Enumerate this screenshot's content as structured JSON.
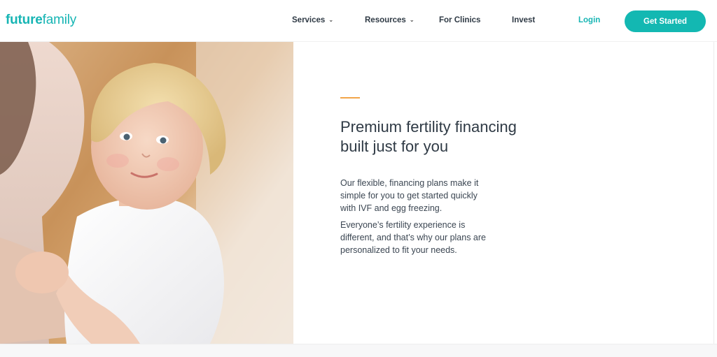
{
  "logo": {
    "part1": "future",
    "part2": "family"
  },
  "nav": {
    "services": "Services",
    "resources": "Resources",
    "clinics": "For Clinics",
    "invest": "Invest",
    "login": "Login",
    "cta": "Get Started"
  },
  "hero": {
    "headline_line1": "Premium fertility financing",
    "headline_line2": "built just for you",
    "para1_line1": "Our flexible, financing plans make it",
    "para1_line2": "simple for you to get started quickly",
    "para1_line3": "with IVF and egg freezing.",
    "para2_line1": "Everyone’s fertility experience is",
    "para2_line2": "different, and that’s why our plans are",
    "para2_line3": "personalized to fit your needs."
  },
  "colors": {
    "brand": "#17b5b4",
    "accent": "#f2a54a",
    "text": "#2f3a45"
  },
  "icons": {
    "dropdown": "chevron-down-icon"
  }
}
